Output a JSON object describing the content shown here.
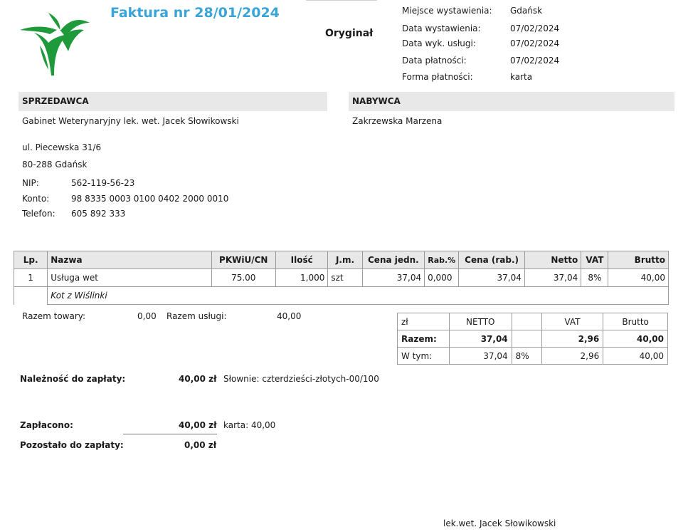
{
  "doc": {
    "title": "Faktura nr 28/01/2024",
    "copy_label": "Oryginał"
  },
  "meta": [
    {
      "label": "Miejsce wystawienia:",
      "value": "Gdańsk"
    },
    {
      "label": "Data wystawienia:",
      "value": "07/02/2024"
    },
    {
      "label": "Data wyk. usługi:",
      "value": "07/02/2024"
    },
    {
      "label": "Data płatności:",
      "value": "07/02/2024"
    },
    {
      "label": "Forma płatności:",
      "value": "karta"
    }
  ],
  "seller": {
    "heading": "SPRZEDAWCA",
    "name": "Gabinet Weterynaryjny lek. wet. Jacek Słowikowski",
    "street": "ul. Piecewska 31/6",
    "city": "80-288 Gdańsk",
    "nip_label": "NIP:",
    "nip": "562-119-56-23",
    "account_label": "Konto:",
    "account": "98 8335 0003 0100 0402 2000 0010",
    "phone_label": "Telefon:",
    "phone": "605 892 333"
  },
  "buyer": {
    "heading": "NABYWCA",
    "name": "Zakrzewska Marzena"
  },
  "items": {
    "headers": [
      "Lp.",
      "Nazwa",
      "PKWiU/CN",
      "Ilość",
      "J.m.",
      "Cena jedn.",
      "Rab.%",
      "Cena (rab.)",
      "Netto",
      "VAT",
      "Brutto"
    ],
    "rows": [
      [
        "1",
        "Usługa wet",
        "75.00",
        "1,000",
        "szt",
        "37,04",
        "0,000",
        "37,04",
        "37,04",
        "8%",
        "40,00"
      ]
    ],
    "note": "Kot z Wiślinki"
  },
  "totals_left": {
    "goods_label": "Razem towary:",
    "goods_value": "0,00",
    "services_label": "Razem usługi:",
    "services_value": "40,00"
  },
  "vat_table": {
    "headers": [
      "zł",
      "NETTO",
      "",
      "VAT",
      "Brutto"
    ],
    "total_row": [
      "Razem:",
      "37,04",
      "",
      "2,96",
      "40,00"
    ],
    "detail_row": [
      "W tym:",
      "37,04",
      "8%",
      "2,96",
      "40,00"
    ]
  },
  "payment": {
    "due_label": "Należność do zapłaty:",
    "due_value": "40,00 zł",
    "words": "Słownie: czterdzieści-złotych-00/100",
    "paid_label": "Zapłacono:",
    "paid_value": "40,00 zł",
    "paid_method": "karta: 40,00",
    "remaining_label": "Pozostało do zapłaty:",
    "remaining_value": "0,00 zł"
  },
  "signature": "lek.wet. Jacek Słowikowski"
}
